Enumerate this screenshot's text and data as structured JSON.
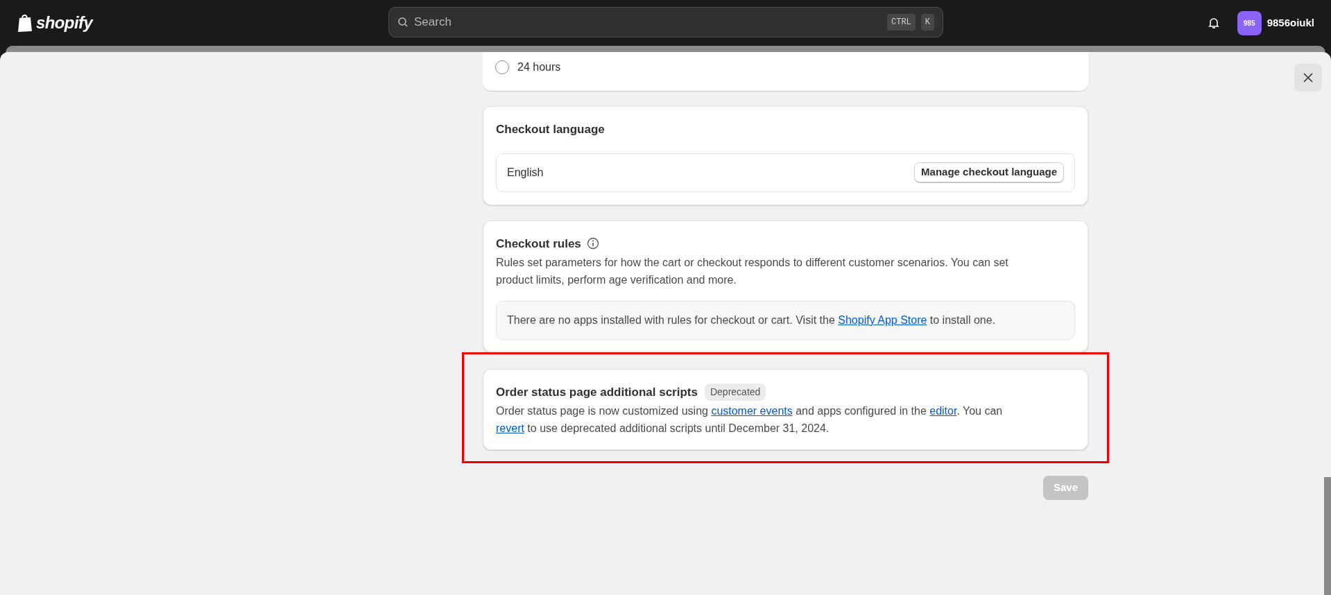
{
  "top_bar": {
    "logo": "shopify",
    "search": {
      "placeholder": "Search",
      "shortcut": [
        "CTRL",
        "K"
      ]
    },
    "account": {
      "initials": "985",
      "name": "9856oiukl"
    }
  },
  "time_option": {
    "label": "24 hours",
    "selected": false
  },
  "checkout_language": {
    "title": "Checkout language",
    "language": "English",
    "button": "Manage checkout language"
  },
  "checkout_rules": {
    "title": "Checkout rules",
    "description": "Rules set parameters for how the cart or checkout responds to different customer scenarios. You can set product limits, perform age verification and more.",
    "notice": [
      {
        "kind": "text",
        "text": "There are no apps installed with rules for checkout or cart. Visit the "
      },
      {
        "kind": "link",
        "text": "Shopify App Store"
      },
      {
        "kind": "text",
        "text": " to install one."
      }
    ]
  },
  "order_status_scripts": {
    "title": "Order status page additional scripts",
    "badge": "Deprecated",
    "description": [
      {
        "kind": "text",
        "text": "Order status page is now customized using "
      },
      {
        "kind": "link",
        "text": "customer events"
      },
      {
        "kind": "text",
        "text": " and apps configured in the "
      },
      {
        "kind": "link",
        "text": "editor"
      },
      {
        "kind": "text",
        "text": ". You can "
      },
      {
        "kind": "link",
        "text": "revert"
      },
      {
        "kind": "text",
        "text": " to use deprecated additional scripts until December 31, 2024."
      }
    ]
  },
  "save_button": {
    "label": "Save",
    "disabled": true
  }
}
